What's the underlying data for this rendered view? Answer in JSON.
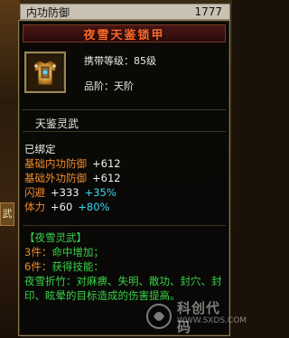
{
  "top_bar": {
    "label": "内功防御",
    "value": "1777"
  },
  "side_tab": {
    "label": "武"
  },
  "tooltip": {
    "title": "夜雪天鉴锁甲",
    "level_label": "携带等级：",
    "level_value": "85级",
    "grade_label": "品阶：",
    "grade_value": "天阶",
    "item_name": "天鉴灵武",
    "bound": "已绑定",
    "stats": [
      {
        "name": "基础内功防御",
        "base": "+612",
        "bonus": ""
      },
      {
        "name": "基础外功防御",
        "base": "+612",
        "bonus": ""
      },
      {
        "name": "闪避",
        "base": "+333",
        "bonus": "+35%"
      },
      {
        "name": "体力",
        "base": "+60",
        "bonus": "+80%"
      }
    ],
    "set": {
      "title": "【夜雪灵武】",
      "piece3_label": "3件：",
      "piece3_effect": "命中增加；",
      "piece6_label": "6件：",
      "piece6_effect": "获得技能：",
      "skill_desc": "夜雪折竹：对麻痹、失明、散功、封穴、封印、眩晕的目标造成的伤害提高。"
    }
  },
  "icons": {
    "item": "armor-icon"
  },
  "watermark": {
    "text": "科创代码",
    "sub": "WWW.SXDS.COM"
  },
  "colors": {
    "title": "#ff6a2a",
    "stat_name": "#f08a2c",
    "bonus": "#38d8f0",
    "set": "#39d24a"
  }
}
